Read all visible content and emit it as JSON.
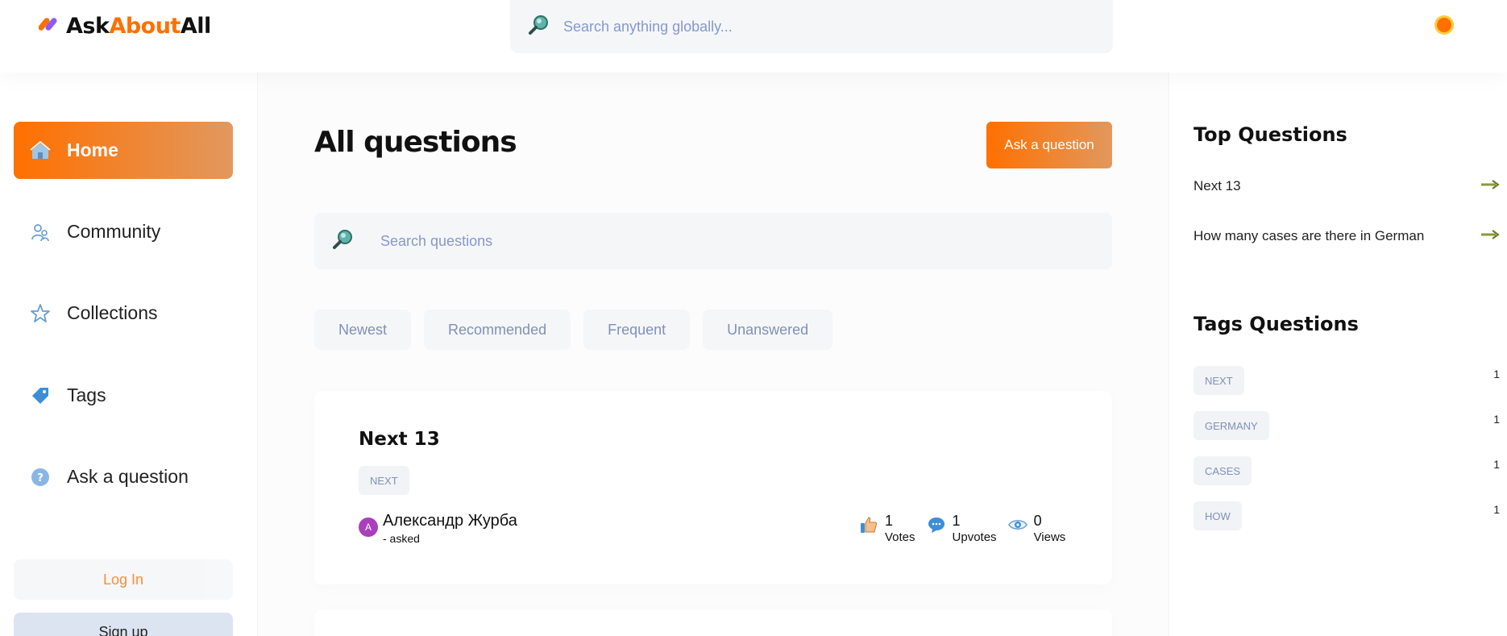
{
  "header": {
    "logo_part1": "Ask",
    "logo_part2": "About",
    "logo_part3": "All",
    "search_placeholder": "Search anything globally..."
  },
  "sidebar": {
    "items": [
      {
        "label": "Home",
        "icon": "home-icon",
        "active": true
      },
      {
        "label": "Community",
        "icon": "users-icon"
      },
      {
        "label": "Collections",
        "icon": "star-icon"
      },
      {
        "label": "Tags",
        "icon": "tag-icon"
      },
      {
        "label": "Ask a question",
        "icon": "question-icon"
      }
    ],
    "login_label": "Log In",
    "signup_label": "Sign up"
  },
  "main": {
    "title": "All questions",
    "ask_button": "Ask a question",
    "search_placeholder": "Search questions",
    "filters": [
      "Newest",
      "Recommended",
      "Frequent",
      "Unanswered"
    ],
    "questions": [
      {
        "title": "Next 13",
        "tags": [
          "NEXT"
        ],
        "author": "Александр Журба",
        "author_initial": "A",
        "asked": "- asked",
        "votes": "1",
        "votes_label": "Votes",
        "upvotes": "1",
        "upvotes_label": "Upvotes",
        "views": "0",
        "views_label": "Views"
      }
    ]
  },
  "right": {
    "top_title": "Top Questions",
    "top_questions": [
      "Next 13",
      "How many cases are there in German"
    ],
    "tags_title": "Tags Questions",
    "tags": [
      {
        "name": "NEXT",
        "count": "1"
      },
      {
        "name": "GERMANY",
        "count": "1"
      },
      {
        "name": "CASES",
        "count": "1"
      },
      {
        "name": "HOW",
        "count": "1"
      }
    ]
  },
  "colors": {
    "primary": "#ff7000",
    "gradient_end": "#e2985e",
    "muted_blue": "#8190b6"
  }
}
